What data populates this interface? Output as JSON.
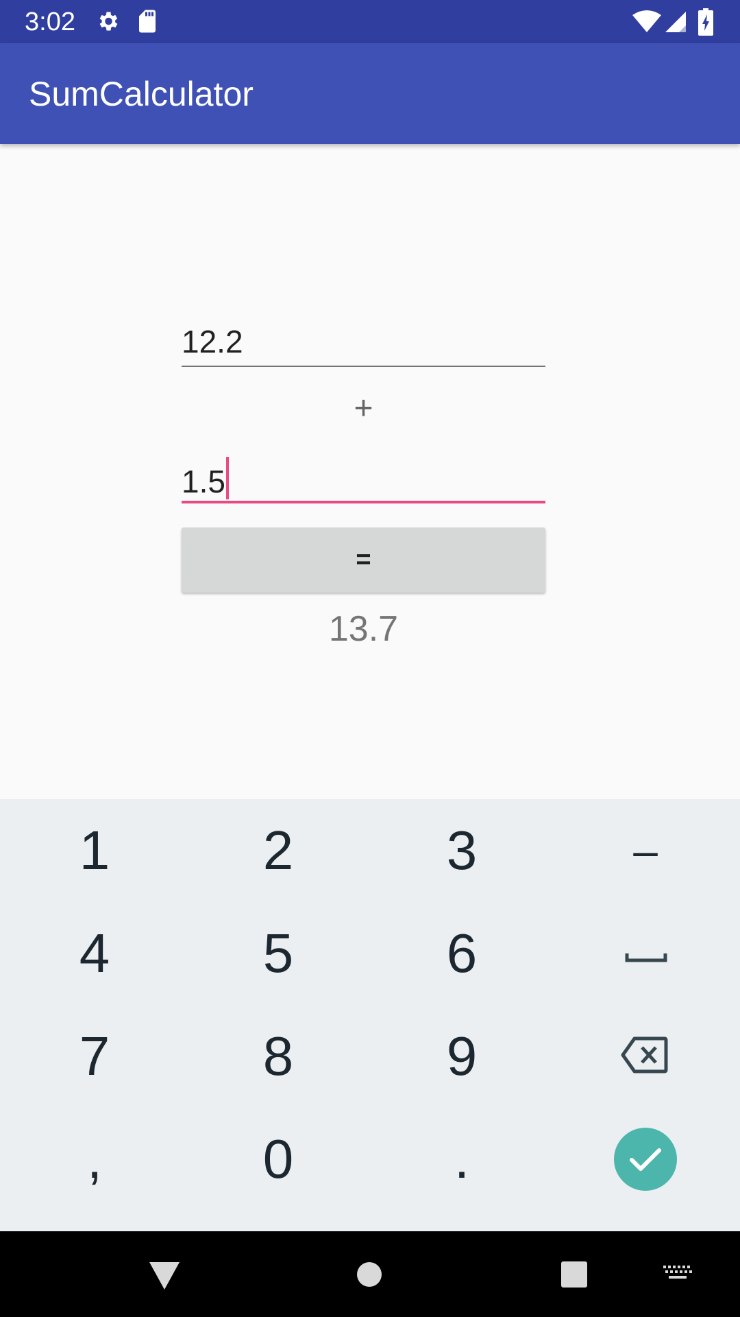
{
  "status_bar": {
    "time": "3:02",
    "icons_left": [
      "gear-icon",
      "sd-card-icon"
    ],
    "icons_right": [
      "wifi-icon",
      "signal-icon",
      "battery-charging-icon"
    ],
    "background": "#303f9f"
  },
  "app_bar": {
    "title": "SumCalculator",
    "background": "#3f51b5"
  },
  "form": {
    "first_value": "12.2",
    "operator": "+",
    "second_value": "1.5",
    "equals_label": "=",
    "result": "13.7",
    "focus_color": "#e84a85"
  },
  "keyboard": {
    "rows": [
      [
        "1",
        "2",
        "3",
        "–"
      ],
      [
        "4",
        "5",
        "6",
        "space"
      ],
      [
        "7",
        "8",
        "9",
        "backspace"
      ],
      [
        ",",
        "0",
        ".",
        "done"
      ]
    ],
    "done_color": "#4db6ac",
    "background": "#eceff1"
  },
  "nav_bar": {
    "buttons": [
      "back-icon",
      "home-icon",
      "recents-icon",
      "keyboard-switch-icon"
    ]
  }
}
